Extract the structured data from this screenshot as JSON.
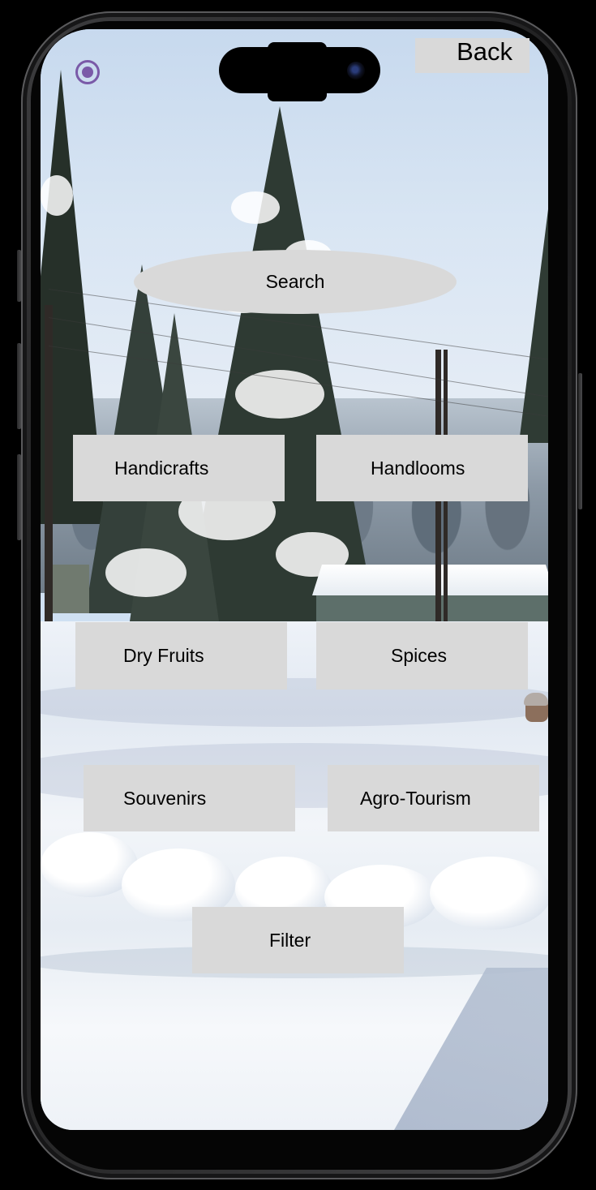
{
  "top_bar": {
    "back_label": "Back"
  },
  "search": {
    "label": "Search"
  },
  "categories": [
    {
      "label": "Handicrafts"
    },
    {
      "label": "Handlooms"
    },
    {
      "label": "Dry Fruits"
    },
    {
      "label": "Spices"
    },
    {
      "label": "Souvenirs"
    },
    {
      "label": "Agro-Tourism"
    }
  ],
  "filter": {
    "label": "Filter"
  },
  "icons": {
    "top_left": "radio-record-icon"
  },
  "colors": {
    "button_fill": "#d9d9d9",
    "record_icon": "#7a5aa8",
    "text": "#000000"
  }
}
